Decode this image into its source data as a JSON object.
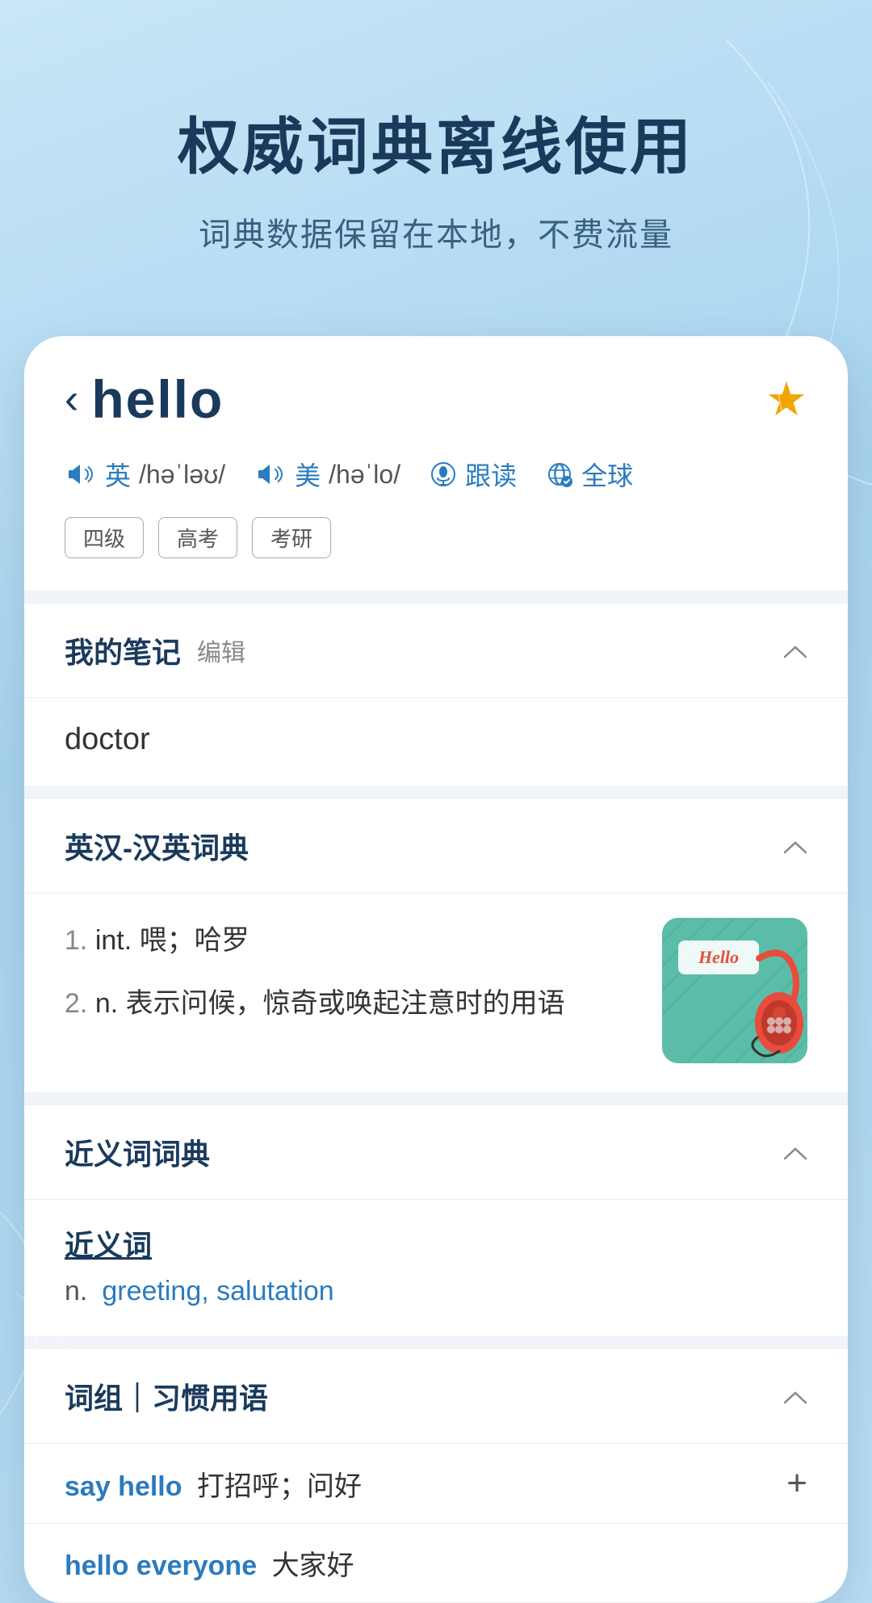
{
  "hero": {
    "title": "权威词典离线使用",
    "subtitle": "词典数据保留在本地，不费流量"
  },
  "word": {
    "back_arrow": "‹",
    "text": "hello",
    "star": "★",
    "pronunciation_en_label": "英",
    "pronunciation_en_phonetic": "/həˈləʊ/",
    "pronunciation_us_label": "美",
    "pronunciation_us_phonetic": "/həˈlo/",
    "follow_read": "跟读",
    "global": "全球",
    "tags": [
      "四级",
      "高考",
      "考研"
    ]
  },
  "notes_section": {
    "title": "我的笔记",
    "edit_label": "编辑",
    "content": "doctor"
  },
  "dictionary_section": {
    "title": "英汉-汉英词典",
    "definitions": [
      {
        "num": "1.",
        "pos": "int.",
        "text": "喂；哈罗"
      },
      {
        "num": "2.",
        "pos": "n.",
        "text": "表示问候，惊奇或唤起注意时的用语"
      }
    ],
    "image_alt": "Hello telephone card illustration"
  },
  "synonym_section": {
    "title": "近义词词典",
    "synonym_header": "近义词",
    "pos": "n.",
    "words": "greeting, salutation"
  },
  "phrases_section": {
    "title": "词组｜习惯用语",
    "phrases": [
      {
        "en": "say hello",
        "cn": "打招呼；问好",
        "has_add": true
      },
      {
        "en": "hello everyone",
        "cn": "大家好",
        "has_add": false
      }
    ]
  },
  "chevron_up": "^",
  "plus_sign": "+"
}
